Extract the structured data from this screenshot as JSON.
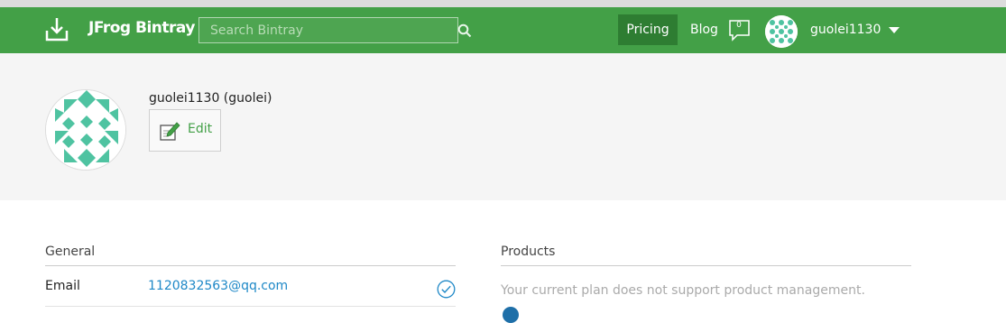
{
  "header": {
    "brand": "JFrog Bintray",
    "search_placeholder": "Search Bintray",
    "pricing_label": "Pricing",
    "blog_label": "Blog",
    "notification_count": "0",
    "username": "guolei1130"
  },
  "profile": {
    "display": "guolei1130  (guolei)",
    "edit_label": "Edit"
  },
  "general": {
    "title": "General",
    "email_label": "Email",
    "email_value": "1120832563@qq.com"
  },
  "products": {
    "title": "Products",
    "message": "Your current plan does not support product management."
  },
  "colors": {
    "nav_green": "#43a047",
    "pricing_bg": "#2e7d32",
    "avatar_teal": "#4fc3a1",
    "link_blue": "#1e88c7"
  },
  "icons": [
    "download-logo-icon",
    "search-icon",
    "comment-icon",
    "chevron-down-icon",
    "edit-icon",
    "check-circle-icon"
  ]
}
